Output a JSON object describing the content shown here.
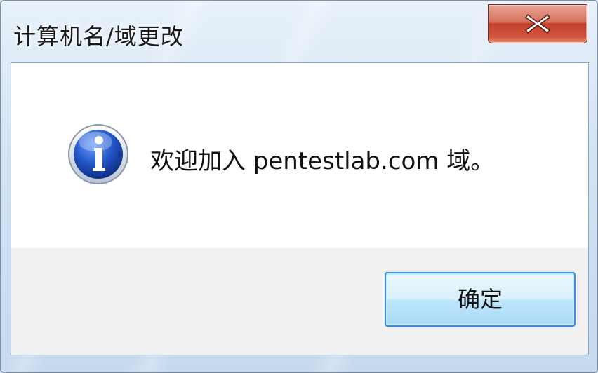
{
  "window": {
    "title": "计算机名/域更改"
  },
  "titlebar": {
    "close_icon": "close-x-icon"
  },
  "message": {
    "icon": "information-icon",
    "text": "欢迎加入 pentestlab.com 域。"
  },
  "buttons": {
    "ok_label": "确定"
  },
  "colors": {
    "title_gradient_top": "#e8f1fb",
    "close_red": "#c2402c",
    "ok_border": "#3c8fd4",
    "info_blue": "#1d4fb8"
  }
}
